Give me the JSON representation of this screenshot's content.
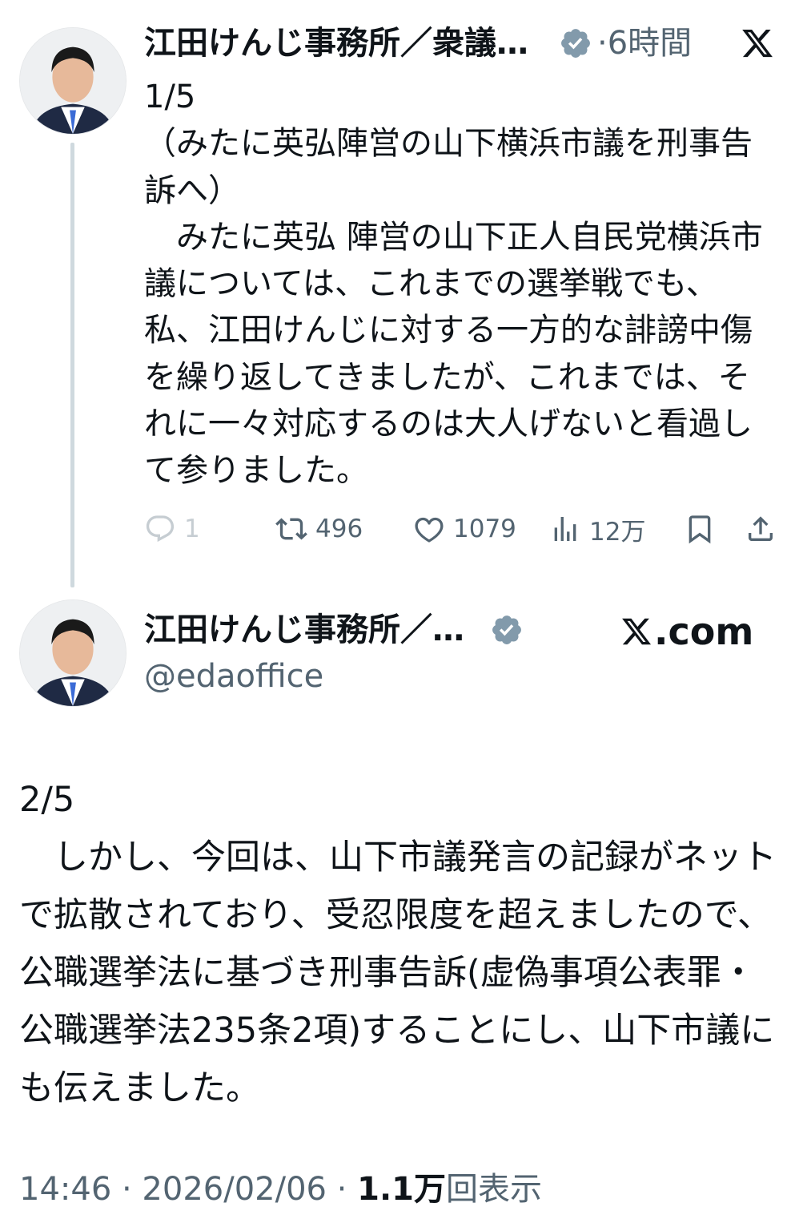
{
  "tweet1": {
    "name": "江田けんじ事務所／衆議…",
    "time": "·6時間",
    "text": "1/5\n（みたに英弘陣営の山下横浜市議を刑事告訴へ）\n　みたに英弘 陣営の山下正人自民党横浜市議については、これまでの選挙戦でも、私、江田けんじに対する一方的な誹謗中傷を繰り返してきましたが、これまでは、それに一々対応するのは大人げないと看過して参りました。",
    "replies": "1",
    "reposts": "496",
    "likes": "1079",
    "views": "12万"
  },
  "tweet2": {
    "name": "江田けんじ事務所／…",
    "handle": "@edaoffice",
    "source": ".com",
    "text": "2/5\n　しかし、今回は、山下市議発言の記録がネットで拡散されており、受忍限度を超えましたので、公職選挙法に基づき刑事告訴(虚偽事項公表罪・公職選挙法235条2項)することにし、山下市議にも伝えました。",
    "time": "14:46 · 2026/02/06 · ",
    "views_count": "1.1万",
    "views_label": "回表示"
  },
  "icons": {
    "verified": "verified-badge-icon",
    "x": "x-logo-icon",
    "reply": "reply-icon",
    "repost": "repost-icon",
    "like": "heart-icon",
    "views": "views-icon",
    "bookmark": "bookmark-icon",
    "share": "share-icon"
  },
  "colors": {
    "text": "#0f1419",
    "muted": "#536471",
    "verified": "#829aab",
    "thread_line": "#cfd9de"
  }
}
